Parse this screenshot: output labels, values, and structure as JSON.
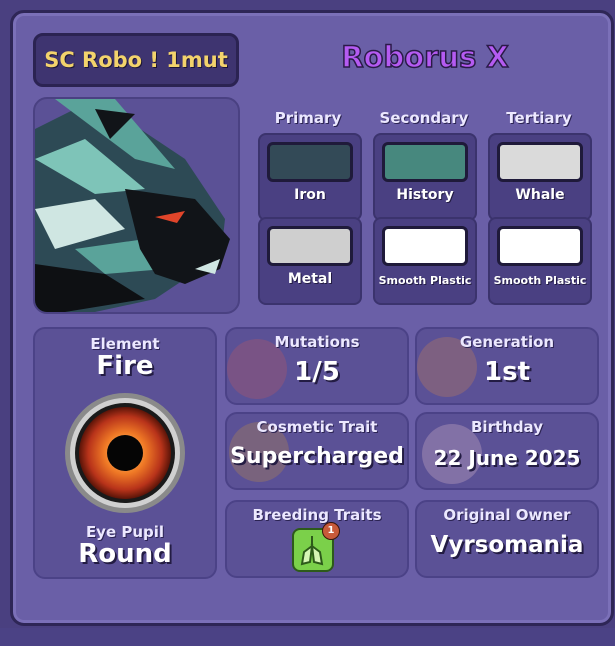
{
  "header": {
    "nickname": "SC Robo ! 1mut",
    "species": "Roborus X"
  },
  "colors": {
    "headers": [
      "Primary",
      "Secondary",
      "Tertiary"
    ],
    "swatches": [
      {
        "label": "Iron",
        "color": "#334a57"
      },
      {
        "label": "History",
        "color": "#47887e"
      },
      {
        "label": "Whale",
        "color": "#dadada"
      },
      {
        "label": "Metal",
        "color": "#cfcfcf"
      },
      {
        "label": "Smooth Plastic",
        "color": "#ffffff"
      },
      {
        "label": "Smooth Plastic",
        "color": "#ffffff"
      }
    ]
  },
  "element": {
    "title": "Element",
    "value": "Fire",
    "pupil_title": "Eye Pupil",
    "pupil_value": "Round"
  },
  "stats": {
    "mutations": {
      "title": "Mutations",
      "value": "1/5"
    },
    "generation": {
      "title": "Generation",
      "value": "1st"
    },
    "cosmetic": {
      "title": "Cosmetic Trait",
      "value": "Supercharged"
    },
    "birthday": {
      "title": "Birthday",
      "value": "22 June 2025"
    },
    "breeding": {
      "title": "Breeding Traits",
      "badge_count": "1"
    },
    "owner": {
      "title": "Original Owner",
      "value": "Vyrsomania"
    }
  }
}
